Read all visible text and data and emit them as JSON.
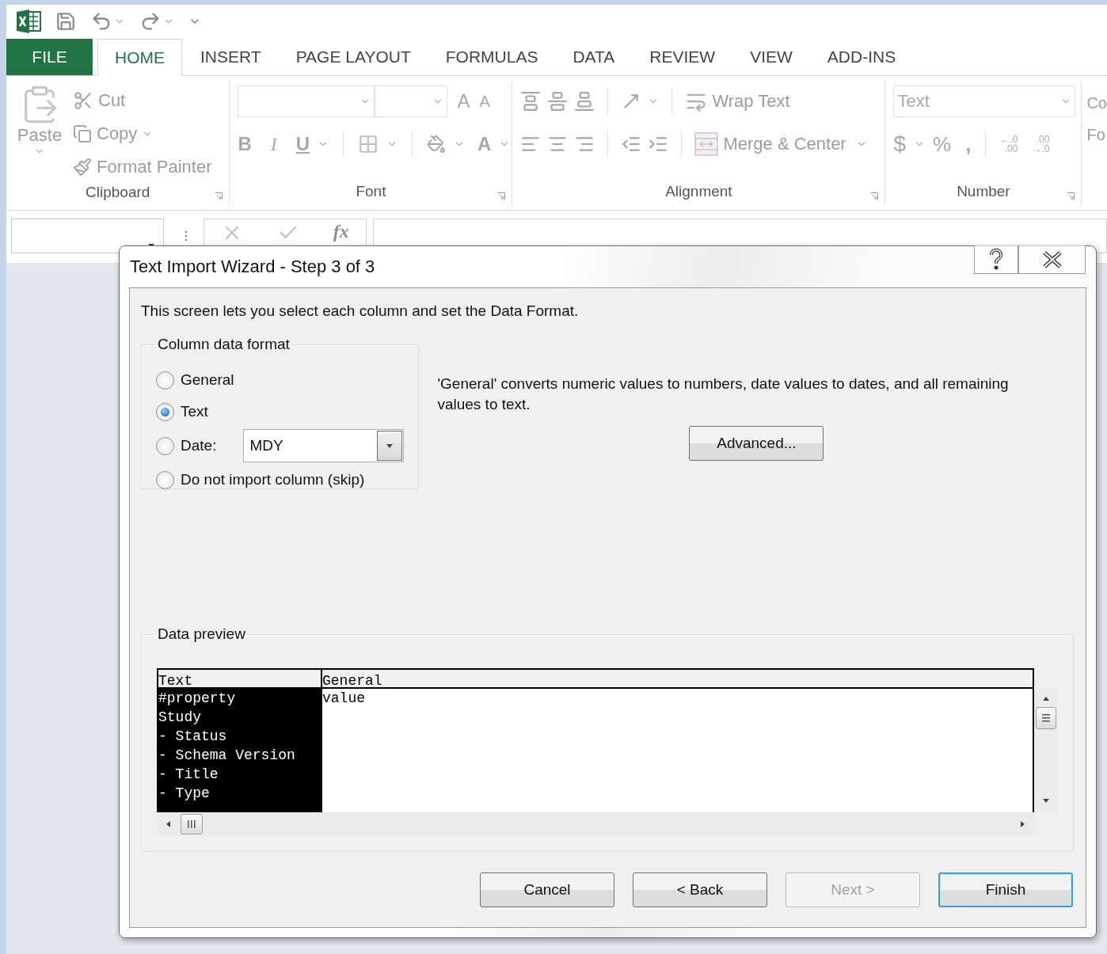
{
  "tabs": [
    {
      "label": "FILE",
      "kind": "file",
      "selected": false
    },
    {
      "label": "HOME",
      "kind": "tab",
      "selected": true
    },
    {
      "label": "INSERT",
      "kind": "tab",
      "selected": false
    },
    {
      "label": "PAGE LAYOUT",
      "kind": "tab",
      "selected": false
    },
    {
      "label": "FORMULAS",
      "kind": "tab",
      "selected": false
    },
    {
      "label": "DATA",
      "kind": "tab",
      "selected": false
    },
    {
      "label": "REVIEW",
      "kind": "tab",
      "selected": false
    },
    {
      "label": "VIEW",
      "kind": "tab",
      "selected": false
    },
    {
      "label": "ADD-INS",
      "kind": "tab",
      "selected": false
    }
  ],
  "ribbon": {
    "clipboard": {
      "paste": "Paste",
      "cut": "Cut",
      "copy": "Copy",
      "format_painter": "Format Painter",
      "label": "Clipboard"
    },
    "font": {
      "grow": "A",
      "shrink": "A",
      "bold": "B",
      "italic": "I",
      "underline": "U",
      "font_color": "A",
      "label": "Font"
    },
    "alignment": {
      "wrap_text": "Wrap Text",
      "merge": "Merge & Center",
      "label": "Alignment"
    },
    "number": {
      "format": "Text",
      "currency": "$",
      "percent": "%",
      "comma": ",",
      "increase_decimal": [
        "←.0",
        ".00"
      ],
      "decrease_decimal": [
        ".00",
        "→.0"
      ],
      "label": "Number"
    },
    "cut_off": [
      "Co",
      "Fo"
    ]
  },
  "formula_bar": {
    "fx": "fx"
  },
  "dialog": {
    "title": "Text Import Wizard - Step 3 of 3",
    "description": "This screen lets you select each column and set the Data Format.",
    "format_group": {
      "label": "Column data format",
      "options": [
        {
          "label": "General",
          "kind": "plain",
          "selected": false
        },
        {
          "label": "Text",
          "kind": "plain",
          "selected": true
        },
        {
          "label": "Date:",
          "kind": "date",
          "selected": false,
          "value": "MDY"
        },
        {
          "label": "Do not import column (skip)",
          "kind": "plain",
          "selected": false
        }
      ]
    },
    "explanation": "'General' converts numeric values to numbers, date values to dates, and all remaining values to text.",
    "advanced_button": "Advanced...",
    "preview": {
      "label": "Data preview",
      "columns": [
        {
          "header": "Text",
          "selected": true,
          "cells": [
            "#property",
            "Study",
            "- Status",
            "- Schema Version",
            "- Title",
            "- Type"
          ]
        },
        {
          "header": "General",
          "selected": false,
          "cells": [
            "value"
          ]
        }
      ]
    },
    "buttons": [
      {
        "label": "Cancel",
        "disabled": false,
        "default": false
      },
      {
        "label": "< Back",
        "disabled": false,
        "default": false
      },
      {
        "label": "Next >",
        "disabled": true,
        "default": false
      },
      {
        "label": "Finish",
        "disabled": false,
        "default": true
      }
    ]
  }
}
